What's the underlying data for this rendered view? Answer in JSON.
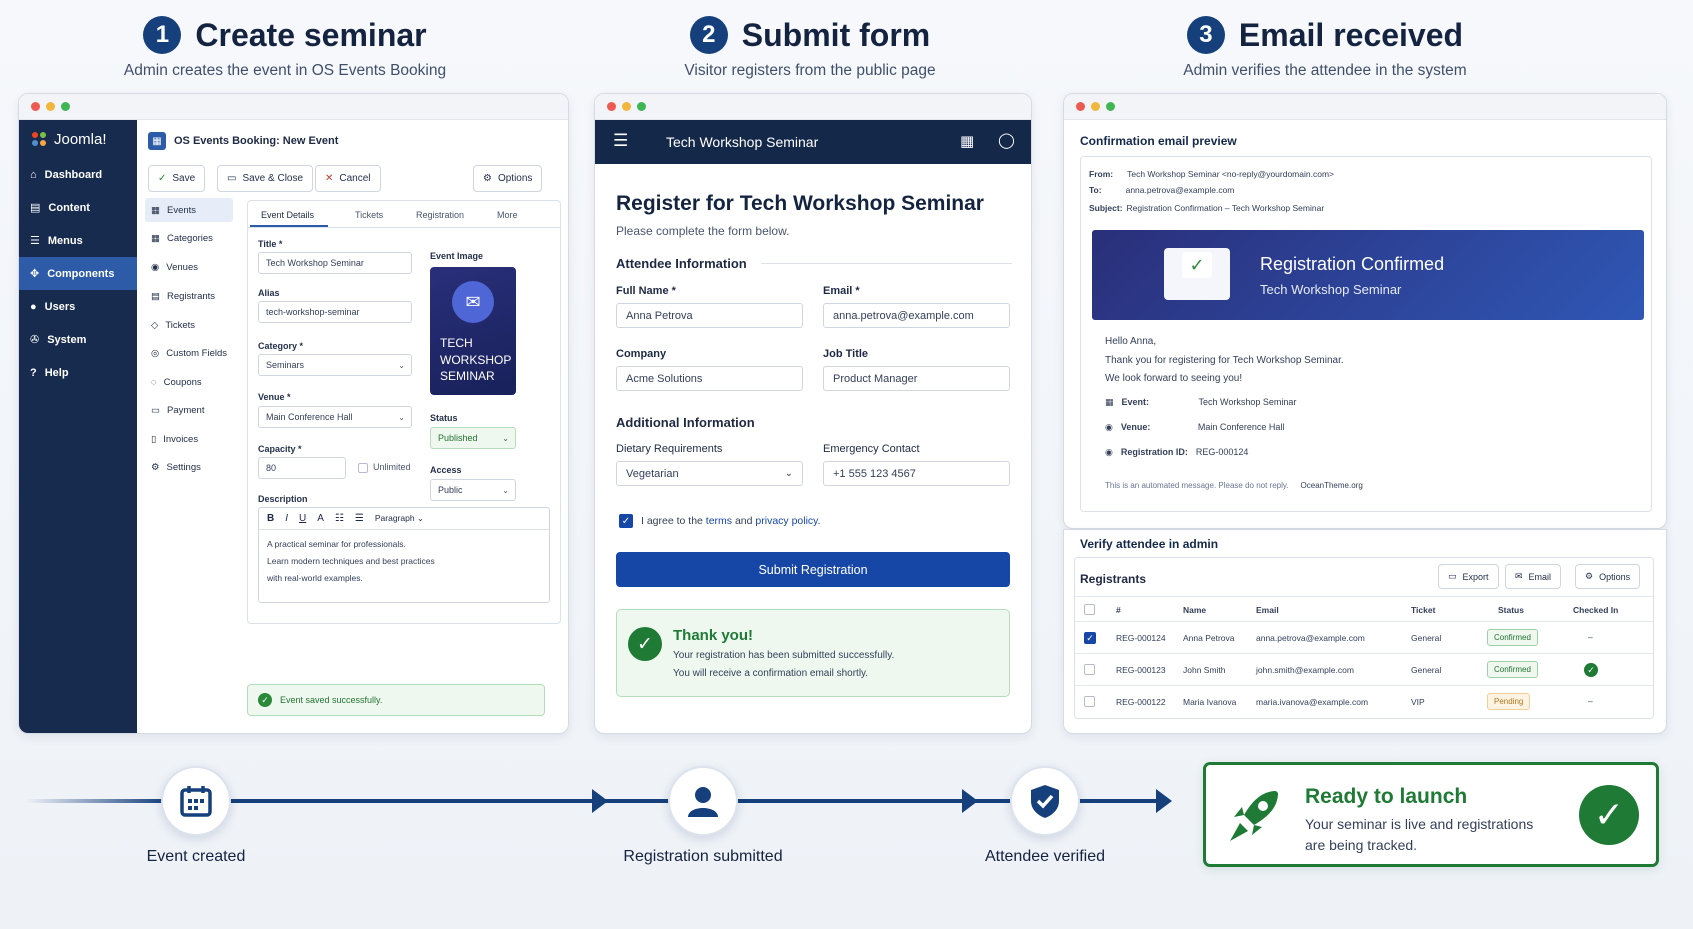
{
  "steps": [
    {
      "num": "1",
      "title": "Create seminar",
      "subtitle": "Admin creates the event in OS Events Booking"
    },
    {
      "num": "2",
      "title": "Submit form",
      "subtitle": "Visitor registers from the public page"
    },
    {
      "num": "3",
      "title": "Email received",
      "subtitle": "Admin verifies the attendee in the system"
    }
  ],
  "joomla": {
    "logo": "Joomla!",
    "menu": [
      "Dashboard",
      "Content",
      "Menus",
      "Components",
      "Users",
      "System",
      "Help"
    ],
    "title": "OS Events Booking: New Event",
    "toolbar": {
      "save": "Save",
      "save_close": "Save & Close",
      "cancel": "Cancel",
      "options": "Options"
    },
    "subnav": [
      "Events",
      "Categories",
      "Venues",
      "Registrants",
      "Tickets",
      "Custom Fields",
      "Coupons",
      "Payment",
      "Invoices",
      "Settings"
    ],
    "tabs": [
      "Event Details",
      "Tickets",
      "Registration",
      "More"
    ],
    "fields": {
      "title_label": "Title *",
      "title": "Tech Workshop Seminar",
      "alias_label": "Alias",
      "alias": "tech-workshop-seminar",
      "category_label": "Category *",
      "category": "Seminars",
      "venue_label": "Venue *",
      "venue": "Main Conference Hall",
      "capacity_label": "Capacity *",
      "capacity": "80",
      "unlimited": "Unlimited",
      "description_label": "Description",
      "paragraph": "Paragraph",
      "description": [
        "A practical seminar for professionals.",
        "Learn modern techniques and best practices",
        "with real-world examples."
      ]
    },
    "image_label": "Event Image",
    "image_text": [
      "TECH",
      "WORKSHOP",
      "SEMINAR"
    ],
    "status_label": "Status",
    "status": "Published",
    "access_label": "Access",
    "access": "Public",
    "saved": "Event saved successfully."
  },
  "register": {
    "app_title": "Tech Workshop Seminar",
    "heading": "Register for Tech Workshop Seminar",
    "sub": "Please complete the form below.",
    "attendee_heading": "Attendee Information",
    "full_name_label": "Full Name *",
    "full_name": "Anna Petrova",
    "email_label": "Email *",
    "email": "anna.petrova@example.com",
    "company_label": "Company",
    "company": "Acme Solutions",
    "job_label": "Job Title",
    "job": "Product Manager",
    "additional_heading": "Additional Information",
    "diet_label": "Dietary Requirements",
    "diet": "Vegetarian",
    "emergency_label": "Emergency Contact",
    "emergency": "+1 555 123 4567",
    "agree_pre": "I agree to the ",
    "terms": "terms",
    "and": " and ",
    "privacy": "privacy policy",
    "agree_post": ".",
    "submit": "Submit Registration",
    "thank_title": "Thank you!",
    "thank_1": "Your registration has been submitted successfully.",
    "thank_2": "You will receive a confirmation email shortly."
  },
  "email": {
    "heading": "Confirmation email preview",
    "from_label": "From:",
    "from": "Tech Workshop Seminar <no-reply@yourdomain.com>",
    "to_label": "To:",
    "to": "anna.petrova@example.com",
    "subject_label": "Subject:",
    "subject": "Registration Confirmation – Tech Workshop Seminar",
    "banner_title": "Registration Confirmed",
    "banner_sub": "Tech Workshop Seminar",
    "hello": "Hello Anna,",
    "thanks": "Thank you for registering for Tech Workshop Seminar.",
    "look": "We look forward to seeing you!",
    "event_label": "Event:",
    "event": "Tech Workshop Seminar",
    "venue_label": "Venue:",
    "venue": "Main Conference Hall",
    "regid_label": "Registration ID:",
    "regid": "REG-000124",
    "footer": "This is an automated message. Please do not reply.",
    "footer_brand": "OceanTheme.org"
  },
  "admin": {
    "heading": "Verify attendee in admin",
    "title": "Registrants",
    "export": "Export",
    "email": "Email",
    "options": "Options",
    "cols": [
      "#",
      "Name",
      "Email",
      "Ticket",
      "Status",
      "Checked In"
    ],
    "rows": [
      {
        "id": "REG-000124",
        "name": "Anna Petrova",
        "email": "anna.petrova@example.com",
        "ticket": "General",
        "status": "Confirmed",
        "checked": "–"
      },
      {
        "id": "REG-000123",
        "name": "John Smith",
        "email": "john.smith@example.com",
        "ticket": "General",
        "status": "Confirmed",
        "checked": ""
      },
      {
        "id": "REG-000122",
        "name": "Maria Ivanova",
        "email": "maria.ivanova@example.com",
        "ticket": "VIP",
        "status": "Pending",
        "checked": "–"
      }
    ]
  },
  "flow": {
    "created": "Event created",
    "submitted": "Registration submitted",
    "verified": "Attendee verified",
    "ready_title": "Ready to launch",
    "ready_text_1": "Your seminar is live and registrations",
    "ready_text_2": "are being tracked."
  },
  "colors": {
    "navy": "#15407c",
    "sidebar": "#172b4e",
    "primary": "#1747a6",
    "success": "#1e7a34"
  }
}
